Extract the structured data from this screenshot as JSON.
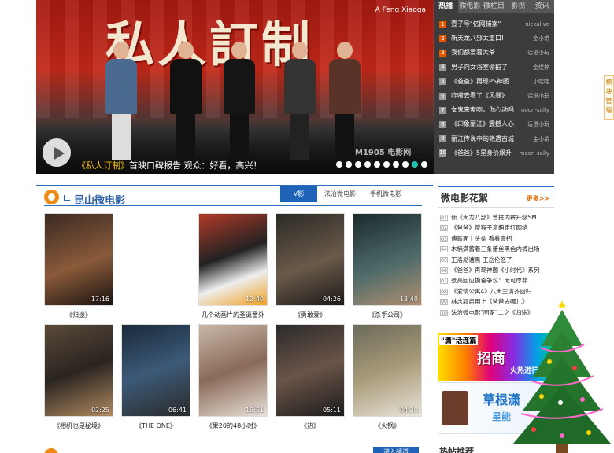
{
  "hero": {
    "title_graphic": "私人訂制",
    "credit": "A Feng Xiaoga",
    "caption_link": "《私人订制》",
    "caption_text": "首映口碑报告 观众：好看，高兴！",
    "watermark": "M1905 电影网",
    "slide_count": 10,
    "active_slide": 9
  },
  "rank": {
    "tabs": [
      "热播",
      "微电影",
      "微栏目",
      "影视",
      "资讯"
    ],
    "active_tab": "热播",
    "items": [
      {
        "num": "1",
        "title": "壹子号\"亿网捕案\"",
        "author": "nickalive",
        "hot": true
      },
      {
        "num": "2",
        "title": "新天龙八部太重口!",
        "author": "金小希",
        "hot": true
      },
      {
        "num": "3",
        "title": "我们都爱葛大爷",
        "author": "话语小玩",
        "hot": true
      },
      {
        "num": "4",
        "title": "男子向女浴室偷拍了!",
        "author": "金煜梓",
        "hot": false
      },
      {
        "num": "5",
        "title": "《爸爸》再现PS神图",
        "author": "小哇哇",
        "hot": false
      },
      {
        "num": "6",
        "title": "咋啦去看了《风暴》!",
        "author": "话语小玩",
        "hot": false
      },
      {
        "num": "7",
        "title": "女鬼来索吻，你心动吗",
        "author": "moon-sally",
        "hot": false
      },
      {
        "num": "8",
        "title": "《印象丽江》震撼人心",
        "author": "话语小玩",
        "hot": false
      },
      {
        "num": "9",
        "title": "丽江传说中的艳遇古城",
        "author": "金小希",
        "hot": false
      },
      {
        "num": "10",
        "title": "《爸爸》5星身价飙升",
        "author": "moon-sally",
        "hot": false
      }
    ]
  },
  "side_float": "模块管理",
  "section": {
    "title": "昆山微电影",
    "tabs": [
      "V影",
      "法治微电影",
      "手机微电影"
    ],
    "active_tab": "V影",
    "videos": [
      {
        "title": "《归途》",
        "duration": "17:16"
      },
      {
        "title": "几个动画片的圣诞番外",
        "duration": "12:40"
      },
      {
        "title": "《勇敢爱》",
        "duration": "04:26"
      },
      {
        "title": "《杀手公司》",
        "duration": "13:40"
      },
      {
        "title": "《相机也是秘境》",
        "duration": "02:25"
      },
      {
        "title": "《THE ONE》",
        "duration": "06:41"
      },
      {
        "title": "《果20的48小时》",
        "duration": "18:51"
      },
      {
        "title": "《热》",
        "duration": "05:11"
      },
      {
        "title": "《火锅》",
        "duration": "04:30"
      }
    ],
    "bottom_button": "进入频道"
  },
  "right": {
    "title": "微电影花絮",
    "more": "更多>>",
    "items": [
      {
        "num": "01",
        "text": "新《天龙八部》曾拄内裤升级SM"
      },
      {
        "num": "02",
        "text": "《爸爸》傻猴子意萌走红网络"
      },
      {
        "num": "03",
        "text": "傅新面上头条 看看高招"
      },
      {
        "num": "04",
        "text": "木桶满蓄着三条蕾丝黑色内裤出场"
      },
      {
        "num": "05",
        "text": "王洛勋遭黑 王岳伦怒了"
      },
      {
        "num": "06",
        "text": "《爸爸》再现神图《小时代》系列"
      },
      {
        "num": "07",
        "text": "张亮回应换爸争议：无可厚非"
      },
      {
        "num": "08",
        "text": "《爱情公寓4》八大主演齐回归"
      },
      {
        "num": "09",
        "text": "林志颖启用上《爸爸去哪儿》"
      },
      {
        "num": "10",
        "text": "法治微电影\"回家\"二之《归途》"
      }
    ],
    "ad1": {
      "tag": "\"潇\"话连篇",
      "big": "招商",
      "small": "火热进行"
    },
    "ad2": {
      "line1": "草根潇",
      "line2": "星能"
    },
    "footer_title": "热帖推荐"
  },
  "colors": {
    "accent_blue": "#1f63b8",
    "accent_orange": "#f08a16",
    "rank_bg": "#3c3c3c"
  }
}
